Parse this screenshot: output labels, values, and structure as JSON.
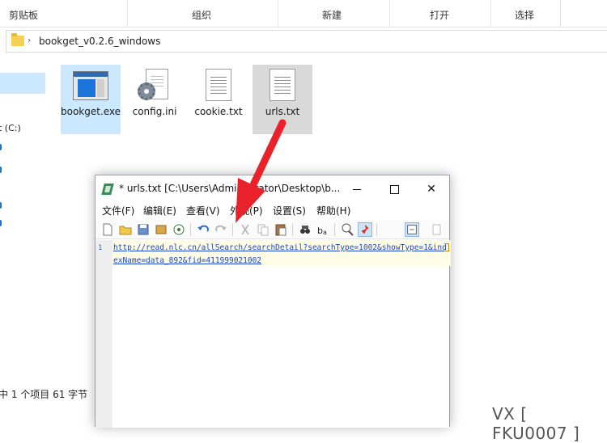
{
  "explorer": {
    "ribbon": {
      "groups": [
        "剪贴板",
        "组织",
        "新建",
        "打开",
        "选择"
      ]
    },
    "address": {
      "path": "bookget_v0.2.6_windows"
    },
    "nav": {
      "drive": "t (C:)"
    },
    "files": [
      {
        "name": "bookget.exe",
        "icon": "exe-icon",
        "selected": true
      },
      {
        "name": "config.ini",
        "icon": "settings-file-icon"
      },
      {
        "name": "cookie.txt",
        "icon": "text-file-icon"
      },
      {
        "name": "urls.txt",
        "icon": "text-file-icon",
        "hover": true
      }
    ],
    "status": "中 1 个项目   61 字节"
  },
  "notepad": {
    "title": "* urls.txt [C:\\Users\\Administrator\\Desktop\\b...",
    "menu": [
      "文件(F)",
      "编辑(E)",
      "查看(V)",
      "外观(P)",
      "设置(S)",
      "帮助(H)"
    ],
    "line_number": "1",
    "content_line1": "http://read.nlc.cn/allSearch/searchDetail?searchType=1002&showType=1&ind",
    "content_line2": "exName=data_892&fid=411999021002",
    "controls": {
      "close": "✕"
    }
  },
  "watermark": "VX [ FKU0007 ]",
  "colors": {
    "arrow": "#e8212b",
    "link": "#1b47c7",
    "selection": "#cce8ff"
  }
}
